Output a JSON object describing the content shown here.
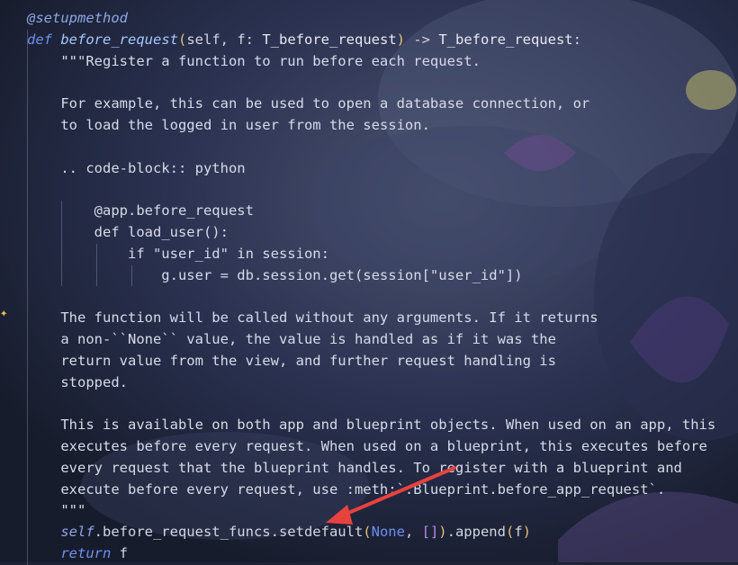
{
  "code": {
    "decorator": "@setupmethod",
    "def_keyword": "def",
    "func_name": "before_request",
    "paren_open": "(",
    "params": "self, f: ",
    "param_type": "T_before_request",
    "paren_close": ")",
    "arrow": " -> ",
    "return_type": "T_before_request",
    "colon": ":",
    "doc_lines": [
      "\"\"\"Register a function to run before each request.",
      "",
      "For example, this can be used to open a database connection, or",
      "to load the logged in user from the session.",
      "",
      ".. code-block:: python",
      "",
      "    @app.before_request",
      "    def load_user():",
      "        if \"user_id\" in session:",
      "            g.user = db.session.get(session[\"user_id\"])",
      "",
      "The function will be called without any arguments. If it returns",
      "a non-``None`` value, the value is handled as if it was the",
      "return value from the view, and further request handling is",
      "stopped.",
      "",
      "This is available on both app and blueprint objects. When used on an app, this",
      "executes before every request. When used on a blueprint, this executes before",
      "every request that the blueprint handles. To register with a blueprint and",
      "execute before every request, use :meth:`.Blueprint.before_app_request`.",
      "\"\"\""
    ],
    "body_self": "self",
    "body_attr": ".before_request_funcs.setdefault",
    "body_args_open": "(",
    "body_none": "None",
    "body_comma": ", ",
    "body_list": "[]",
    "body_args_close": ")",
    "body_append": ".append",
    "body_append_arg_open": "(",
    "body_append_arg": "f",
    "body_append_arg_close": ")",
    "return_keyword": "return",
    "return_value": " f"
  },
  "icons": {
    "sparkle": "sparkle-icon",
    "arrow": "annotation-arrow"
  },
  "colors": {
    "keyword": "#6f8ff0",
    "text": "#d2d6e2",
    "bracket": "#e2c07a",
    "bracket2": "#c286e6",
    "arrow": "#e8423f",
    "sparkle": "#f2c14e"
  }
}
